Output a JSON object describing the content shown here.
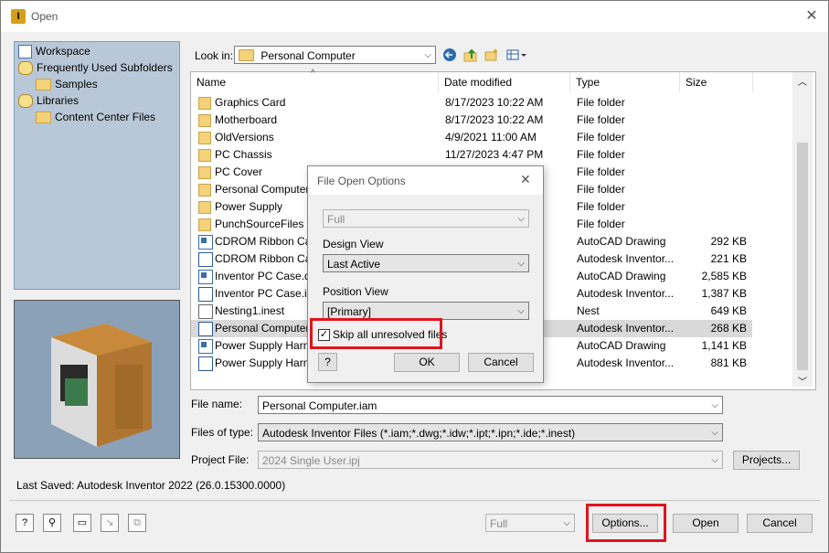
{
  "window": {
    "title": "Open",
    "icon_char": "I"
  },
  "sidebar": {
    "items": [
      {
        "label": "Workspace",
        "icon": "workspace-icon"
      },
      {
        "label": "Frequently Used Subfolders",
        "icon": "library-icon"
      },
      {
        "label": "Samples",
        "icon": "folder-icon"
      },
      {
        "label": "Libraries",
        "icon": "library-icon"
      },
      {
        "label": "Content Center Files",
        "icon": "folder-icon"
      }
    ]
  },
  "lookin": {
    "label": "Look in:",
    "value": "Personal Computer"
  },
  "toolbar": {
    "back_icon": "back-arrow-icon",
    "up_icon": "up-folder-icon",
    "new_folder_icon": "new-folder-icon",
    "views_icon": "views-menu-icon"
  },
  "columns": {
    "name": "Name",
    "date": "Date modified",
    "type": "Type",
    "size": "Size"
  },
  "files": [
    {
      "name": "Graphics Card",
      "date": "8/17/2023 10:22 AM",
      "type": "File folder",
      "size": "",
      "kind": "folder"
    },
    {
      "name": "Motherboard",
      "date": "8/17/2023 10:22 AM",
      "type": "File folder",
      "size": "",
      "kind": "folder"
    },
    {
      "name": "OldVersions",
      "date": "4/9/2021 11:00 AM",
      "type": "File folder",
      "size": "",
      "kind": "folder"
    },
    {
      "name": "PC Chassis",
      "date": "11/27/2023 4:47 PM",
      "type": "File folder",
      "size": "",
      "kind": "folder"
    },
    {
      "name": "PC Cover",
      "date": "",
      "type": "File folder",
      "size": "",
      "kind": "folder"
    },
    {
      "name": "Personal Computer",
      "date": "",
      "type": "File folder",
      "size": "",
      "kind": "folder"
    },
    {
      "name": "Power Supply",
      "date": "",
      "type": "File folder",
      "size": "",
      "kind": "folder"
    },
    {
      "name": "PunchSourceFiles",
      "date": "",
      "type": "File folder",
      "size": "",
      "kind": "folder"
    },
    {
      "name": "CDROM Ribbon Cab",
      "date": "",
      "type": "AutoCAD Drawing",
      "size": "292 KB",
      "kind": "dwg"
    },
    {
      "name": "CDROM Ribbon Cab",
      "date": "",
      "type": "Autodesk Inventor...",
      "size": "221 KB",
      "kind": "inv"
    },
    {
      "name": "Inventor PC Case.dw",
      "date": "",
      "type": "AutoCAD Drawing",
      "size": "2,585 KB",
      "kind": "dwg"
    },
    {
      "name": "Inventor PC Case.idw",
      "date": "",
      "type": "Autodesk Inventor...",
      "size": "1,387 KB",
      "kind": "inv"
    },
    {
      "name": "Nesting1.inest",
      "date": "",
      "type": "Nest",
      "size": "649 KB",
      "kind": "nest"
    },
    {
      "name": "Personal Computer",
      "date": "",
      "type": "Autodesk Inventor...",
      "size": "268 KB",
      "kind": "inv",
      "selected": true
    },
    {
      "name": "Power Supply Harn",
      "date": "",
      "type": "AutoCAD Drawing",
      "size": "1,141 KB",
      "kind": "dwg"
    },
    {
      "name": "Power Supply Harne",
      "date": "",
      "type": "Autodesk Inventor...",
      "size": "881 KB",
      "kind": "inv"
    }
  ],
  "form": {
    "filename_label": "File name:",
    "filename_value": "Personal Computer.iam",
    "filetype_label": "Files of type:",
    "filetype_value": "Autodesk Inventor Files (*.iam;*.dwg;*.idw;*.ipt;*.ipn;*.ide;*.inest)",
    "project_label": "Project File:",
    "project_value": "2024 Single User.ipj",
    "projects_button": "Projects..."
  },
  "last_saved": "Last Saved: Autodesk Inventor 2022 (26.0.15300.0000)",
  "bottom": {
    "lod_value": "Full",
    "options_button": "Options...",
    "open_button": "Open",
    "cancel_button": "Cancel"
  },
  "dialog": {
    "title": "File Open Options",
    "top_combo": "Full",
    "design_view_label": "Design View",
    "design_view_value": "Last Active",
    "position_view_label": "Position View",
    "position_view_value": "[Primary]",
    "skip_label": "Skip all unresolved files",
    "skip_checked": "✓",
    "help_glyph": "?",
    "ok_button": "OK",
    "cancel_button": "Cancel"
  },
  "colors": {
    "highlight_red": "#e0141e",
    "selection_gray": "#d9d9d9",
    "sidebar_blue": "#b9c8d8"
  }
}
